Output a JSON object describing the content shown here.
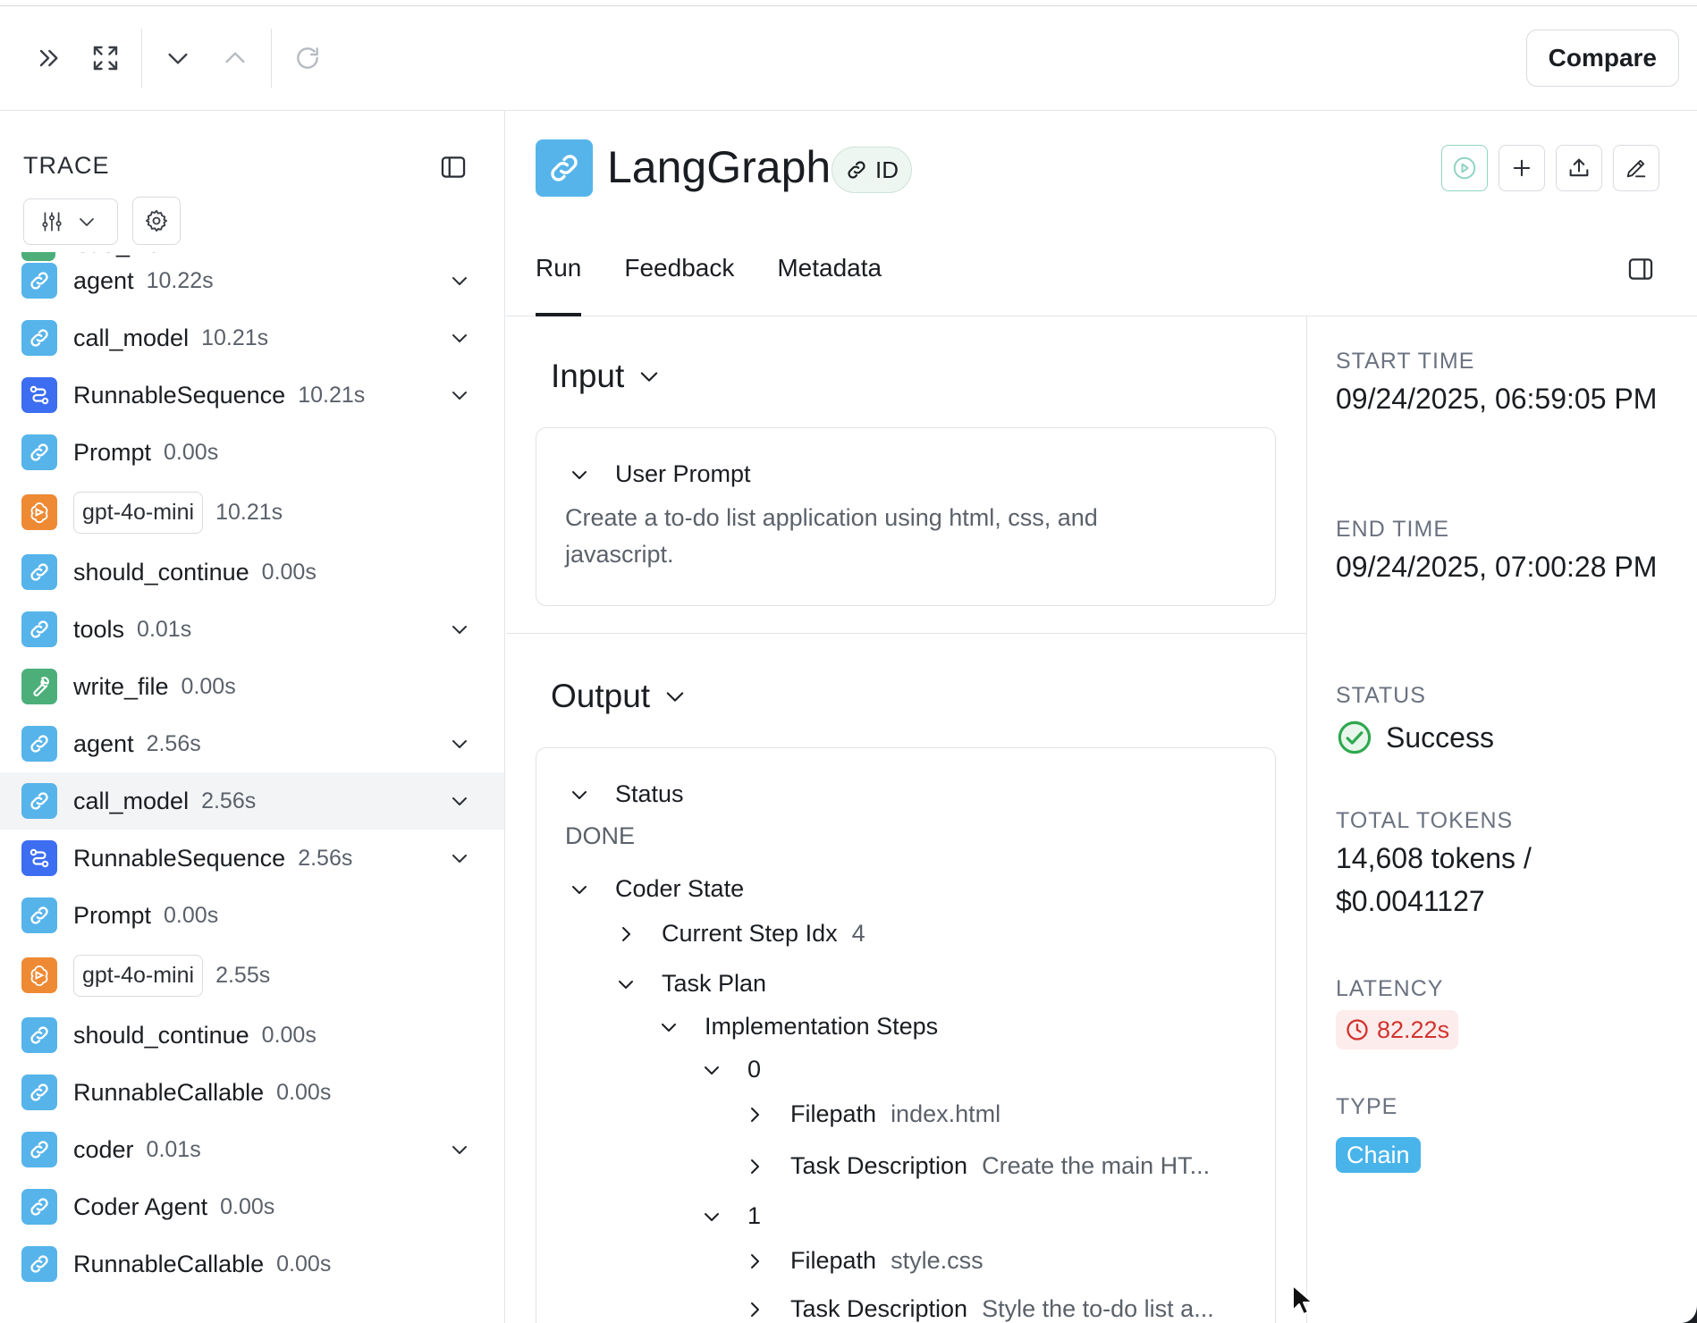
{
  "toolbar": {
    "compare_label": "Compare",
    "buttons": [
      "expand-panel-icon",
      "fullscreen-icon",
      "next-icon",
      "previous-icon",
      "refresh-icon"
    ]
  },
  "trace": {
    "title": "TRACE",
    "peek_name": "read_file",
    "rows": [
      {
        "name": "agent",
        "duration": "10.22s",
        "kind": "chain",
        "expandable": true
      },
      {
        "name": "call_model",
        "duration": "10.21s",
        "kind": "chain",
        "expandable": true
      },
      {
        "name": "RunnableSequence",
        "duration": "10.21s",
        "kind": "seq",
        "expandable": true
      },
      {
        "name": "Prompt",
        "duration": "0.00s",
        "kind": "chain",
        "expandable": false
      },
      {
        "name": "gpt-4o-mini",
        "duration": "10.21s",
        "kind": "llm",
        "expandable": false
      },
      {
        "name": "should_continue",
        "duration": "0.00s",
        "kind": "chain",
        "expandable": false
      },
      {
        "name": "tools",
        "duration": "0.01s",
        "kind": "chain",
        "expandable": true
      },
      {
        "name": "write_file",
        "duration": "0.00s",
        "kind": "tool",
        "expandable": false
      },
      {
        "name": "agent",
        "duration": "2.56s",
        "kind": "chain",
        "expandable": true
      },
      {
        "name": "call_model",
        "duration": "2.56s",
        "kind": "chain",
        "expandable": true,
        "selected": true
      },
      {
        "name": "RunnableSequence",
        "duration": "2.56s",
        "kind": "seq",
        "expandable": true
      },
      {
        "name": "Prompt",
        "duration": "0.00s",
        "kind": "chain",
        "expandable": false
      },
      {
        "name": "gpt-4o-mini",
        "duration": "2.55s",
        "kind": "llm",
        "expandable": false
      },
      {
        "name": "should_continue",
        "duration": "0.00s",
        "kind": "chain",
        "expandable": false
      },
      {
        "name": "RunnableCallable",
        "duration": "0.00s",
        "kind": "chain",
        "expandable": false
      },
      {
        "name": "coder",
        "duration": "0.01s",
        "kind": "chain",
        "expandable": true
      },
      {
        "name": "Coder Agent",
        "duration": "0.00s",
        "kind": "chain",
        "expandable": false
      },
      {
        "name": "RunnableCallable",
        "duration": "0.00s",
        "kind": "chain",
        "expandable": false
      }
    ]
  },
  "run": {
    "title": "LangGraph",
    "id_label": "ID",
    "tabs": [
      "Run",
      "Feedback",
      "Metadata"
    ],
    "active_tab": "Run"
  },
  "input": {
    "title": "Input",
    "user_prompt_label": "User Prompt",
    "user_prompt_text": "Create a to-do list application using html, css, and javascript."
  },
  "output": {
    "title": "Output",
    "status_label": "Status",
    "status_value": "DONE",
    "coder_state_label": "Coder State",
    "current_step_label": "Current Step Idx",
    "current_step_value": "4",
    "task_plan_label": "Task Plan",
    "impl_steps_label": "Implementation Steps",
    "steps": [
      {
        "index": "0",
        "filepath_label": "Filepath",
        "filepath": "index.html",
        "desc_label": "Task Description",
        "desc": "Create the main HT..."
      },
      {
        "index": "1",
        "filepath_label": "Filepath",
        "filepath": "style.css",
        "desc_label": "Task Description",
        "desc": "Style the to-do list a..."
      }
    ]
  },
  "details": {
    "start_label": "START TIME",
    "start_value": "09/24/2025, 06:59:05 PM",
    "end_label": "END TIME",
    "end_value": "09/24/2025, 07:00:28 PM",
    "status_label": "STATUS",
    "status_value": "Success",
    "tokens_label": "TOTAL TOKENS",
    "tokens_value": "14,608 tokens / $0.0041127",
    "latency_label": "LATENCY",
    "latency_value": "82.22s",
    "type_label": "TYPE",
    "type_value": "Chain"
  },
  "colors": {
    "chain_icon": "#56b4ea",
    "sequence_icon": "#3d6df0",
    "llm_icon": "#ee8a34",
    "tool_icon": "#4caf7a",
    "success": "#2fa84f",
    "latency_red": "#d1342f"
  }
}
